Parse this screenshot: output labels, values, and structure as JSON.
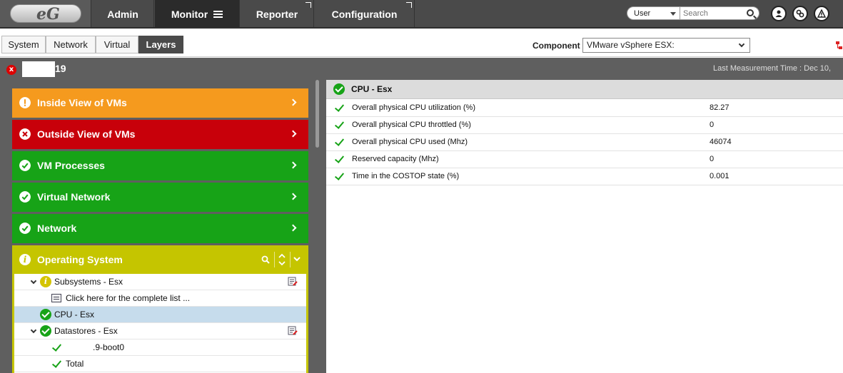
{
  "nav": {
    "logo_text": "eG",
    "admin": "Admin",
    "monitor": "Monitor",
    "reporter": "Reporter",
    "configuration": "Configuration",
    "user_select": "User",
    "search_placeholder": "Search"
  },
  "tabs": {
    "system": "System",
    "network": "Network",
    "virtual": "Virtual",
    "layers": "Layers"
  },
  "component": {
    "label": "Component",
    "selected": "VMware vSphere ESX:"
  },
  "title_band": {
    "status_glyph": "x",
    "server_name_suffix": "19",
    "last_measurement": "Last Measurement Time : Dec 10,"
  },
  "layers": [
    {
      "label": "Inside View of VMs",
      "status": "warning",
      "color": "#f59a1e"
    },
    {
      "label": "Outside View of VMs",
      "status": "critical",
      "color": "#c8000a"
    },
    {
      "label": "VM Processes",
      "status": "ok",
      "color": "#17a317"
    },
    {
      "label": "Virtual Network",
      "status": "ok",
      "color": "#17a317"
    },
    {
      "label": "Network",
      "status": "ok",
      "color": "#17a317"
    }
  ],
  "os_layer": {
    "label": "Operating System",
    "color": "#c5c500",
    "tree": {
      "subsystems": "Subsystems - Esx",
      "complete_list": "Click here for the complete list ...",
      "cpu": "CPU - Esx",
      "datastores": "Datastores - Esx",
      "boot": ".9-boot0",
      "total": "Total"
    }
  },
  "metrics": {
    "header": "CPU - Esx",
    "rows": [
      {
        "name": "Overall physical CPU utilization (%)",
        "value": "82.27"
      },
      {
        "name": "Overall physical CPU throttled (%)",
        "value": "0"
      },
      {
        "name": "Overall physical CPU used (Mhz)",
        "value": "46074"
      },
      {
        "name": "Reserved capacity (Mhz)",
        "value": "0"
      },
      {
        "name": "Time in the COSTOP state (%)",
        "value": "0.001"
      }
    ]
  }
}
